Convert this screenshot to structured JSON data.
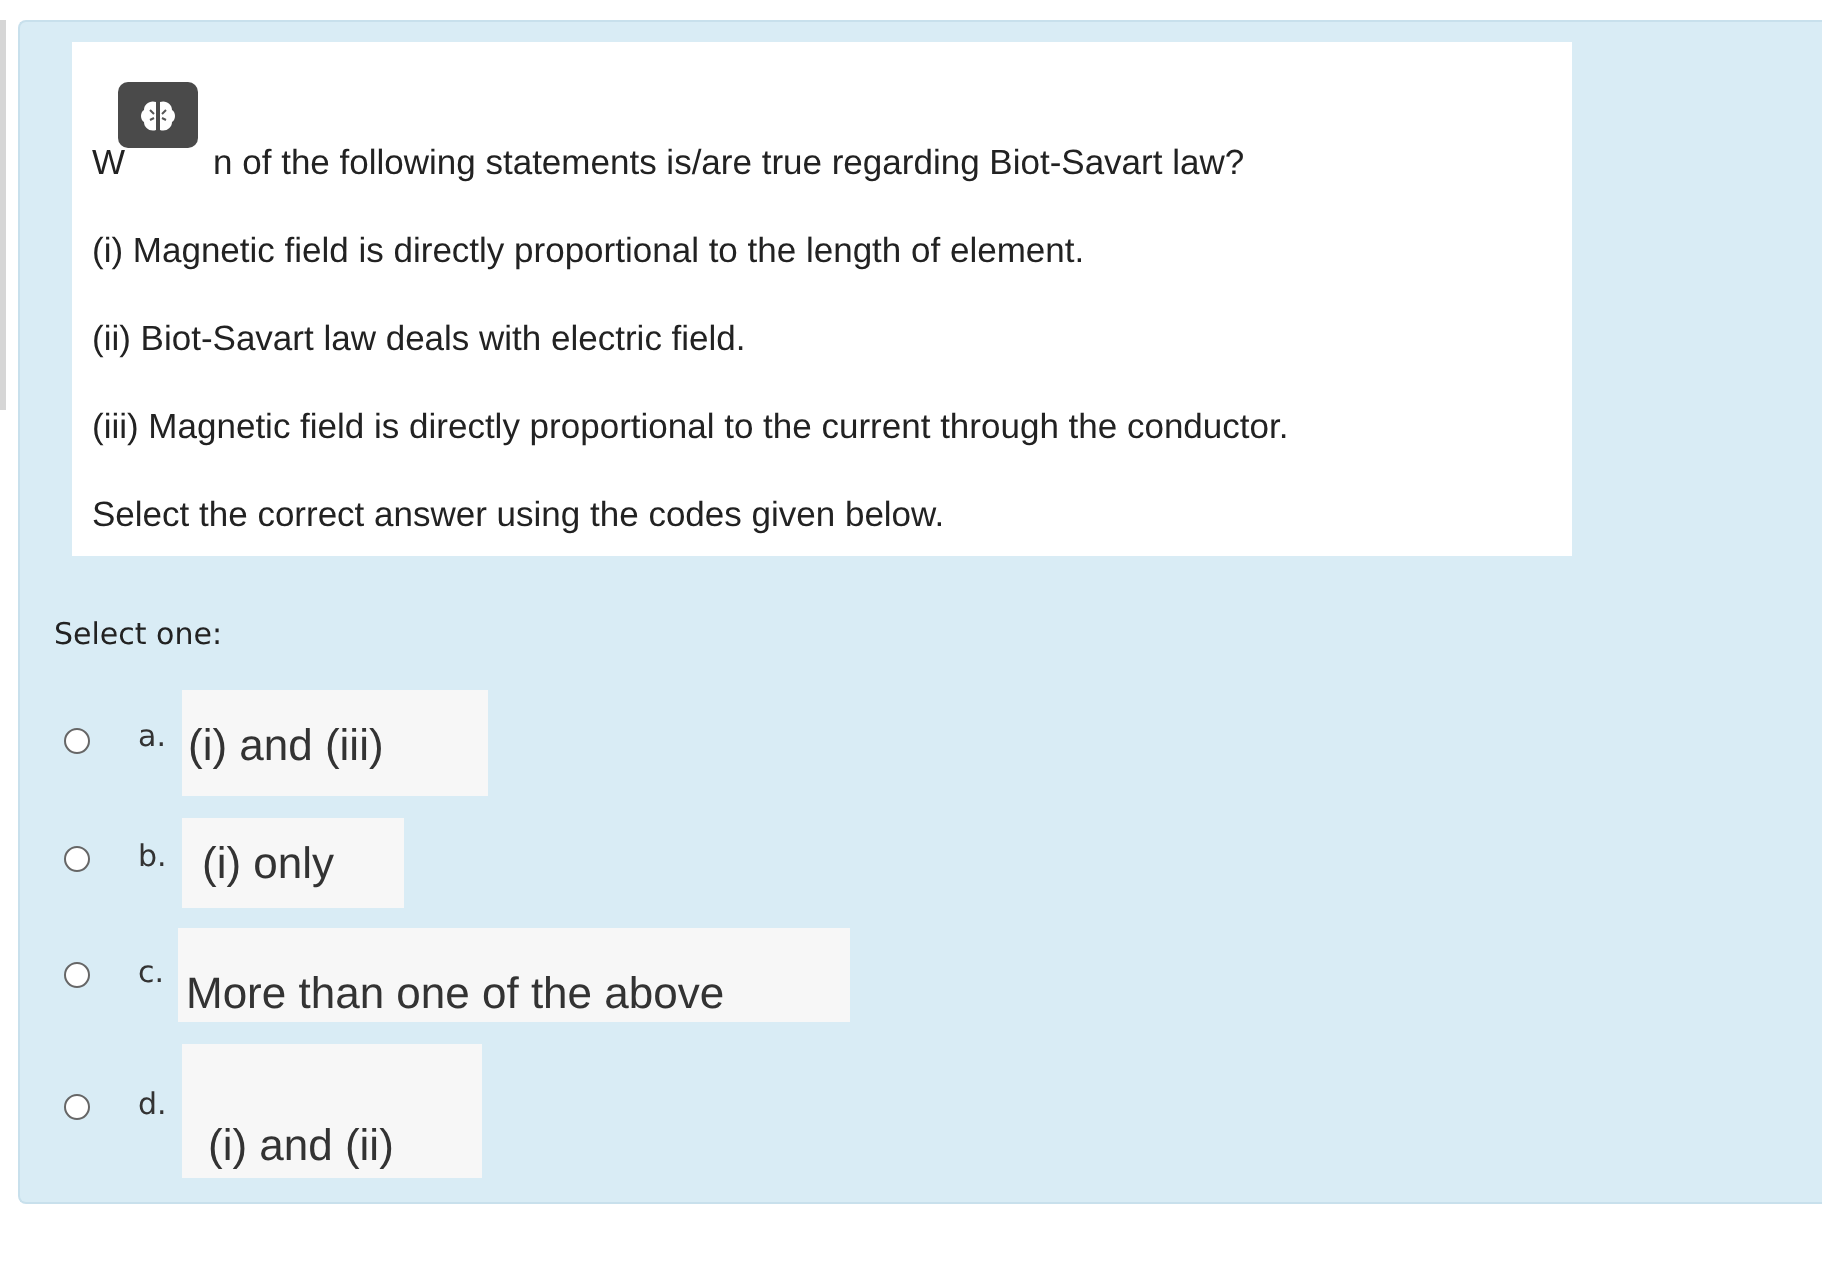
{
  "question": {
    "first_line_start": "W",
    "first_line_rest": "n of the following statements is/are true regarding Biot-Savart law?",
    "lines": [
      "(i) Magnetic field is directly proportional to the length of element.",
      "(ii) Biot-Savart law deals with electric field.",
      "(iii) Magnetic field is directly proportional to the current through the conductor.",
      "Select the correct answer using the codes given below."
    ]
  },
  "prompt": "Select one:",
  "options": [
    {
      "letter": "a.",
      "text": "(i) and (iii)",
      "selected": false
    },
    {
      "letter": "b.",
      "text": "(i) only",
      "selected": false
    },
    {
      "letter": "c.",
      "text": "More than one of the above",
      "selected": false
    },
    {
      "letter": "d.",
      "text": "(i) and (ii)",
      "selected": false
    }
  ]
}
